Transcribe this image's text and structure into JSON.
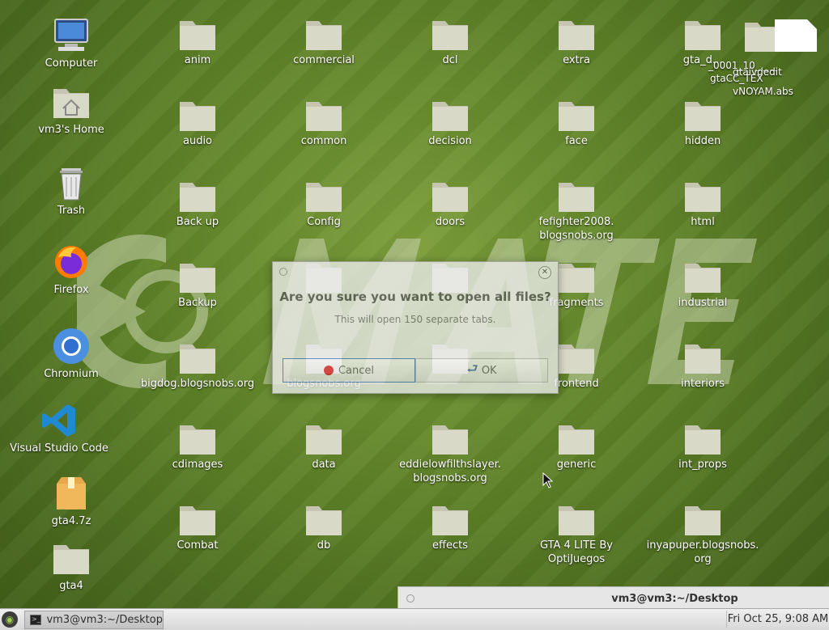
{
  "desktop": {
    "left_icons": [
      {
        "name": "Computer",
        "type": "computer"
      },
      {
        "name": "vm3's Home",
        "type": "home"
      },
      {
        "name": "Trash",
        "type": "trash"
      },
      {
        "name": "Firefox",
        "type": "firefox"
      },
      {
        "name": "Chromium",
        "type": "chromium"
      },
      {
        "name": "Visual Studio Code",
        "type": "vscode"
      },
      {
        "name": "gta4.7z",
        "type": "archive"
      },
      {
        "name": "gta4",
        "type": "folder"
      }
    ],
    "folders": [
      {
        "line1": "anim",
        "line2": ""
      },
      {
        "line1": "commercial",
        "line2": ""
      },
      {
        "line1": "dcl",
        "line2": ""
      },
      {
        "line1": "extra",
        "line2": ""
      },
      {
        "line1": "gta_d...",
        "line2": ""
      },
      {
        "line1": "audio",
        "line2": ""
      },
      {
        "line1": "common",
        "line2": ""
      },
      {
        "line1": "decision",
        "line2": ""
      },
      {
        "line1": "face",
        "line2": ""
      },
      {
        "line1": "hidden",
        "line2": ""
      },
      {
        "line1": "Back up",
        "line2": ""
      },
      {
        "line1": "Config",
        "line2": ""
      },
      {
        "line1": "doors",
        "line2": ""
      },
      {
        "line1": "fefighter2008.",
        "line2": "blogsnobs.org"
      },
      {
        "line1": "html",
        "line2": ""
      },
      {
        "line1": "Backup",
        "line2": ""
      },
      {
        "line1": "",
        "line2": ""
      },
      {
        "line1": "",
        "line2": ""
      },
      {
        "line1": "fragments",
        "line2": ""
      },
      {
        "line1": "industrial",
        "line2": ""
      },
      {
        "line1": "bigdog.blogsnobs.org",
        "line2": ""
      },
      {
        "line1": "blogsnobs.org",
        "line2": ""
      },
      {
        "line1": "",
        "line2": ""
      },
      {
        "line1": "frontend",
        "line2": ""
      },
      {
        "line1": "interiors",
        "line2": ""
      },
      {
        "line1": "cdimages",
        "line2": ""
      },
      {
        "line1": "data",
        "line2": ""
      },
      {
        "line1": "eddielowfilthslayer.",
        "line2": "blogsnobs.org"
      },
      {
        "line1": "generic",
        "line2": ""
      },
      {
        "line1": "int_props",
        "line2": ""
      },
      {
        "line1": "Combat",
        "line2": ""
      },
      {
        "line1": "db",
        "line2": ""
      },
      {
        "line1": "effects",
        "line2": ""
      },
      {
        "line1": "GTA 4 LITE By",
        "line2": "OptiJuegos"
      },
      {
        "line1": "inyapuper.blogsnobs.",
        "line2": "org"
      }
    ],
    "overlapping_labels": [
      "_0001_10_ _ _",
      "gtaivdedit",
      "gtaCC_TEX",
      "vNOYAM.abs"
    ]
  },
  "dialog": {
    "question": "Are you sure you want to open all files?",
    "detail": "This will open 150 separate tabs.",
    "cancel_label": "Cancel",
    "ok_label": "OK",
    "close_glyph": "✕"
  },
  "terminal_window": {
    "title": "vm3@vm3:~/Desktop"
  },
  "taskbar": {
    "task_label": "vm3@vm3:~/Desktop",
    "clock": "Fri Oct 25,  9:08 AM"
  },
  "colors": {
    "folder_body": "#d9d9c8",
    "folder_tab": "#c5c5b2",
    "accent_cancel": "#d12020",
    "logo_fill": "#c8d4ae"
  }
}
